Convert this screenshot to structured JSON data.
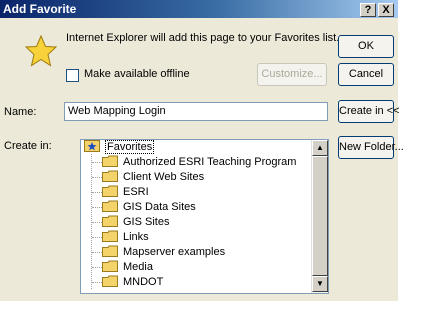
{
  "window": {
    "title": "Add Favorite",
    "help_label": "?",
    "close_label": "X"
  },
  "info": {
    "message": "Internet Explorer will add this page to your Favorites list.",
    "offline_label": "Make available offline",
    "offline_checked": false
  },
  "buttons": {
    "ok": "OK",
    "cancel": "Cancel",
    "customize": "Customize...",
    "create_in": "Create in <<",
    "new_folder": "New Folder..."
  },
  "name_field": {
    "label": "Name:",
    "value": "Web Mapping Login"
  },
  "create_in": {
    "label": "Create in:",
    "root": "Favorites",
    "root_selected": true,
    "folders": [
      "Authorized ESRI Teaching Program",
      "Client Web Sites",
      "ESRI",
      "GIS Data Sites",
      "GIS Sites",
      "Links",
      "Mapserver examples",
      "Media",
      "MNDOT"
    ]
  },
  "colors": {
    "title_bar": "#0a246a",
    "dialog_face": "#ece9d8",
    "folder": "#f5d36b",
    "star": "#f8d23a"
  },
  "icons": {
    "favorites": "star-icon",
    "folder": "folder-icon"
  }
}
